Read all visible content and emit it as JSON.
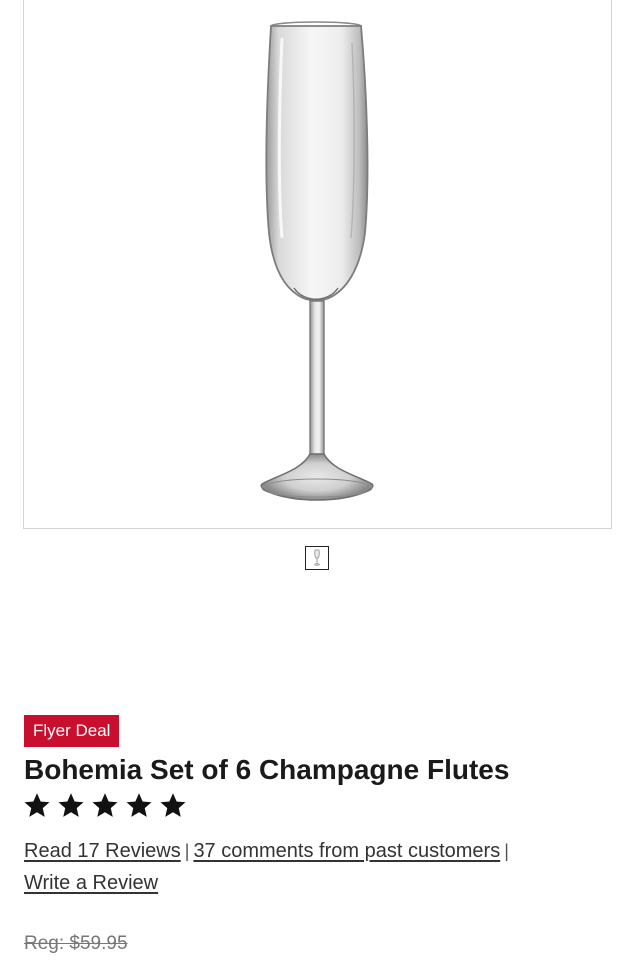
{
  "product": {
    "image_alt": "Bohemia champagne flute",
    "thumbnail_icon": "champagne-flute-thumbnail",
    "badge": "Flyer Deal",
    "title": "Bohemia Set of 6 Champagne Flutes",
    "rating": {
      "stars": 5,
      "max": 5,
      "icon": "star-icon"
    },
    "links": {
      "read_reviews": "Read 17 Reviews",
      "comments": "37 comments from past customers",
      "separator": "|",
      "write_review": "Write a Review"
    },
    "price": {
      "regular": "Reg: $59.95"
    }
  },
  "colors": {
    "badge_bg": "#c8102e",
    "text": "#1a1a1a",
    "link": "#333333",
    "muted": "#777777"
  }
}
